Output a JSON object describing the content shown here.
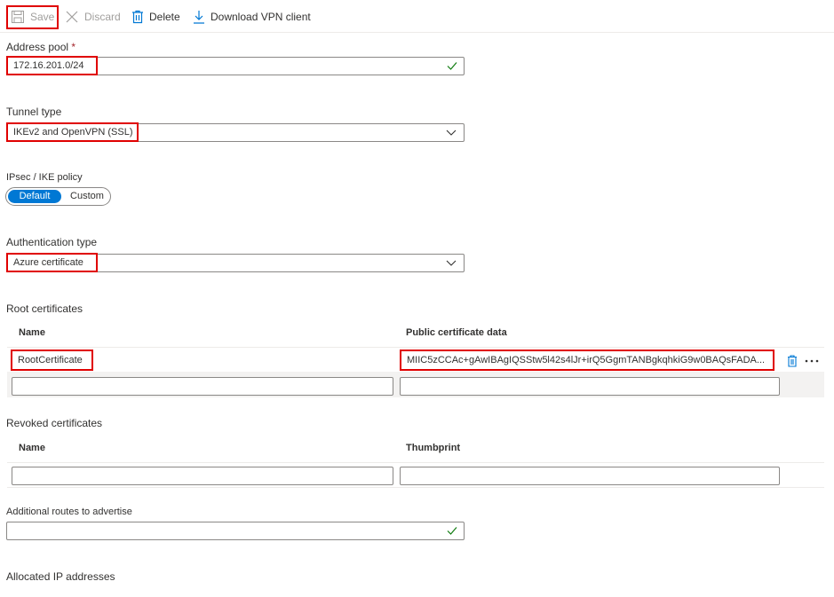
{
  "toolbar": {
    "save": "Save",
    "discard": "Discard",
    "delete": "Delete",
    "download": "Download VPN client"
  },
  "address_pool": {
    "label": "Address pool",
    "required_mark": "*",
    "value": "172.16.201.0/24"
  },
  "tunnel_type": {
    "label": "Tunnel type",
    "value": "IKEv2 and OpenVPN (SSL)"
  },
  "ipsec_policy": {
    "label": "IPsec / IKE policy",
    "options": [
      "Default",
      "Custom"
    ],
    "selected": "Default"
  },
  "auth_type": {
    "label": "Authentication type",
    "value": "Azure certificate"
  },
  "root_certs": {
    "section_label": "Root certificates",
    "columns": [
      "Name",
      "Public certificate data"
    ],
    "rows": [
      {
        "name": "RootCertificate",
        "data": "MIIC5zCCAc+gAwIBAgIQSStw5l42s4lJr+irQ5GgmTANBgkqhkiG9w0BAQsFADA..."
      }
    ]
  },
  "revoked_certs": {
    "section_label": "Revoked certificates",
    "columns": [
      "Name",
      "Thumbprint"
    ]
  },
  "additional_routes": {
    "label": "Additional routes to advertise",
    "value": ""
  },
  "allocated_ip": {
    "label": "Allocated IP addresses"
  },
  "colors": {
    "accent": "#0078d4",
    "highlight": "#e00000",
    "valid": "#107c10"
  }
}
